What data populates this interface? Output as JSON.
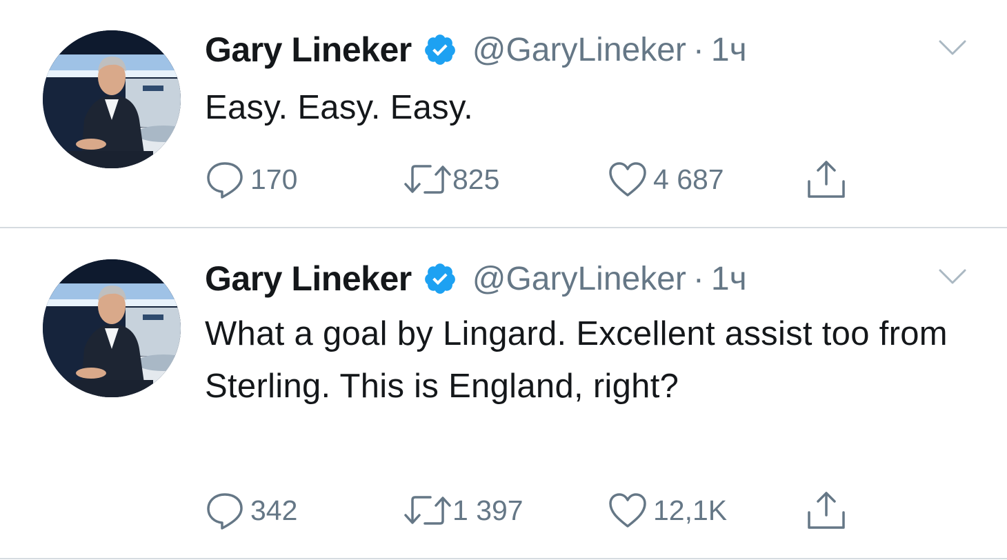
{
  "tweets": [
    {
      "author_name": "Gary Lineker",
      "handle": "@GaryLineker",
      "separator": "·",
      "time": "1ч",
      "text": "Easy. Easy. Easy.",
      "replies": "170",
      "retweets": "825",
      "likes": "4 687"
    },
    {
      "author_name": "Gary Lineker",
      "handle": "@GaryLineker",
      "separator": "·",
      "time": "1ч",
      "text": "What a goal by Lingard. Excellent assist too from Sterling. This is England, right?",
      "replies": "342",
      "retweets": "1 397",
      "likes": "12,1K"
    }
  ],
  "icons": {
    "verified": "verified-badge-icon",
    "caret": "chevron-down-icon",
    "reply": "reply-bubble-icon",
    "retweet": "retweet-icon",
    "like": "heart-icon",
    "share": "share-icon"
  },
  "colors": {
    "text_primary": "#14171a",
    "text_secondary": "#657786",
    "verified_blue": "#1da1f2",
    "divider": "#d5dbe0"
  }
}
